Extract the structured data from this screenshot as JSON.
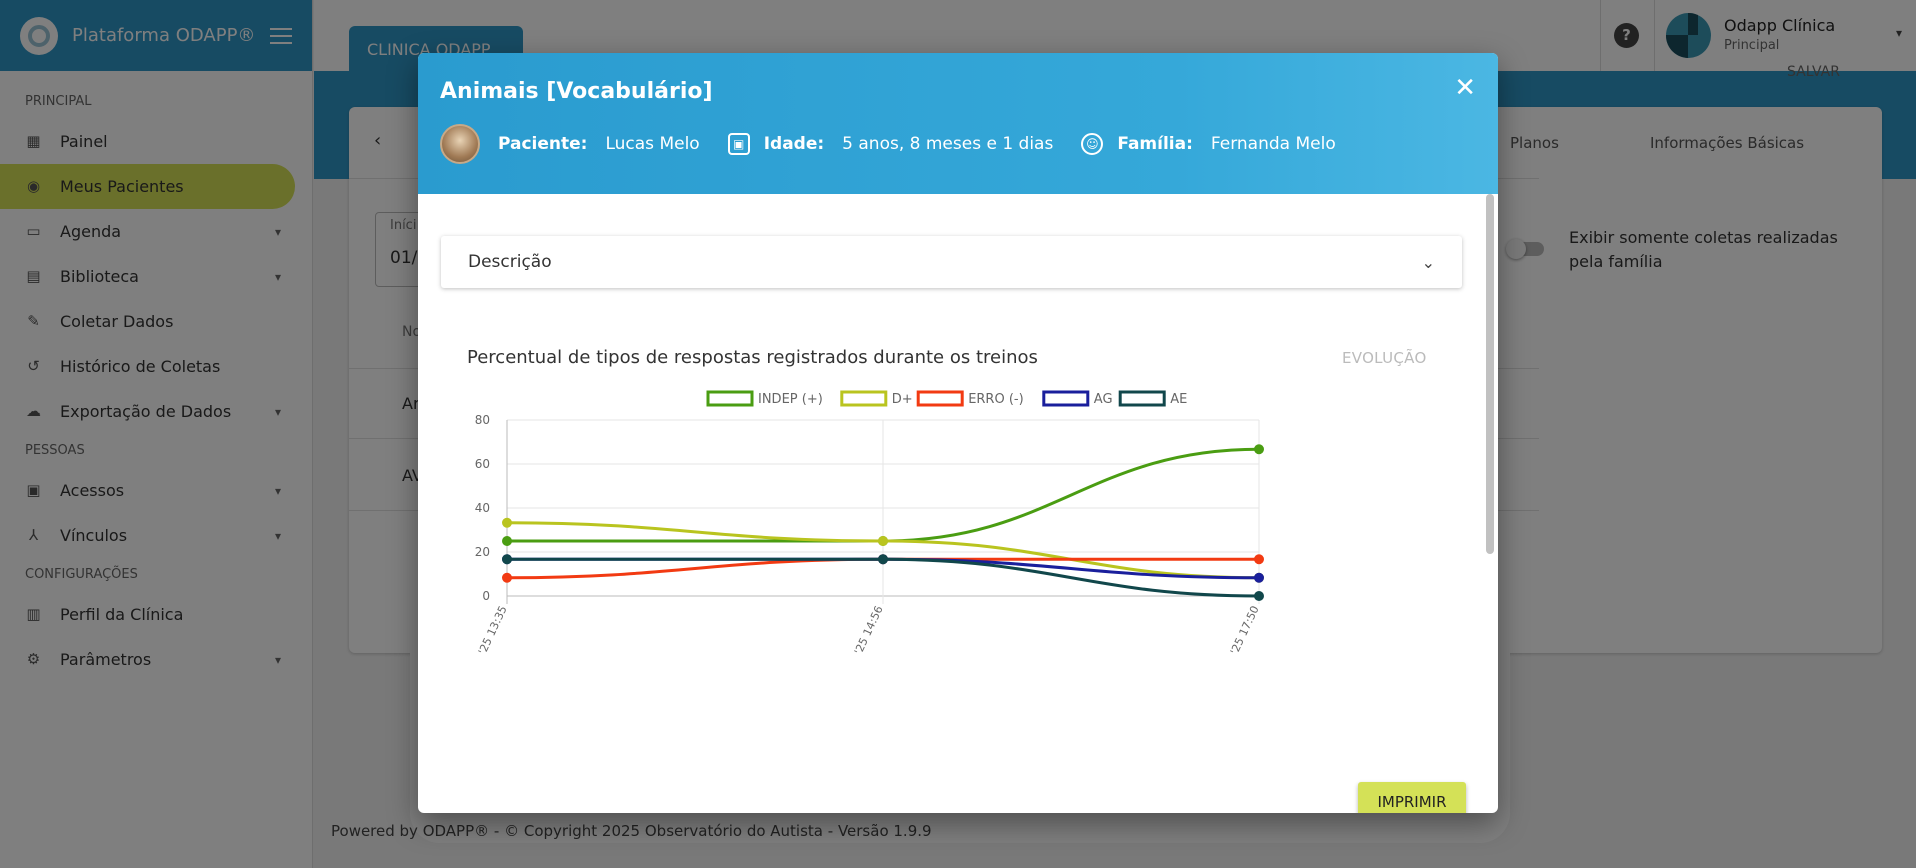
{
  "app": {
    "title": "Plataforma ODAPP®",
    "clinic_tab": "CLINICA ODAPP",
    "saved_hint": "SALVAR"
  },
  "sidebar": {
    "sections": [
      {
        "label": "PRINCIPAL"
      },
      {
        "label": "PESSOAS"
      },
      {
        "label": "CONFIGURAÇÕES"
      }
    ],
    "items": [
      {
        "label": "Painel",
        "icon": "dashboard-icon"
      },
      {
        "label": "Meus Pacientes",
        "icon": "eye-icon",
        "active": true
      },
      {
        "label": "Agenda",
        "icon": "calendar-icon"
      },
      {
        "label": "Biblioteca",
        "icon": "library-icon"
      },
      {
        "label": "Coletar Dados",
        "icon": "pencil-icon"
      },
      {
        "label": "Histórico de Coletas",
        "icon": "history-icon"
      },
      {
        "label": "Exportação de Dados",
        "icon": "cloud-icon"
      },
      {
        "label": "Acessos",
        "icon": "access-icon"
      },
      {
        "label": "Vínculos",
        "icon": "network-icon"
      },
      {
        "label": "Perfil da Clínica",
        "icon": "building-icon"
      },
      {
        "label": "Parâmetros",
        "icon": "gear-icon"
      }
    ]
  },
  "user": {
    "name": "Odapp Clínica",
    "role": "Principal"
  },
  "background": {
    "tabs": [
      "Planos",
      "Informações Básicas"
    ],
    "field_label": "Iníci",
    "field_value": "01/",
    "col_header": "No",
    "row1": "Ar",
    "row2": "AV",
    "toggle_label": "Exibir somente coletas realizadas pela família"
  },
  "footer": "Powered by ODAPP® - © Copyright 2025 Observatório do Autista - Versão 1.9.9",
  "modal": {
    "title": "Animais [Vocabulário]",
    "patient_label": "Paciente:",
    "patient_name": "Lucas Melo",
    "age_label": "Idade:",
    "age_value": "5 anos, 8 meses e 1 dias",
    "family_label": "Família:",
    "family_value": "Fernanda Melo",
    "description_label": "Descrição",
    "chart_title": "Percentual de tipos de respostas registrados durante os treinos",
    "evolution_label": "EVOLUÇÃO",
    "print_label": "IMPRIMIR"
  },
  "chart_data": {
    "type": "line",
    "title": "",
    "x": [
      "'25 13:35",
      "'25 14:56",
      "'25 17:50"
    ],
    "ylim": [
      0,
      80
    ],
    "yticks": [
      0,
      20,
      40,
      60,
      80
    ],
    "grid": true,
    "legend_position": "top",
    "series": [
      {
        "name": "INDEP (+)",
        "color": "#4a9d12",
        "values": [
          25,
          25,
          66.7
        ]
      },
      {
        "name": "D+",
        "color": "#b9c41f",
        "values": [
          33.3,
          25,
          8.3
        ]
      },
      {
        "name": "ERRO (-)",
        "color": "#f23a12",
        "values": [
          8.3,
          16.7,
          16.7
        ]
      },
      {
        "name": "AG",
        "color": "#1a1f9c",
        "values": [
          16.7,
          16.7,
          8.3
        ]
      },
      {
        "name": "AE",
        "color": "#11474b",
        "values": [
          16.7,
          16.7,
          0
        ]
      }
    ]
  }
}
